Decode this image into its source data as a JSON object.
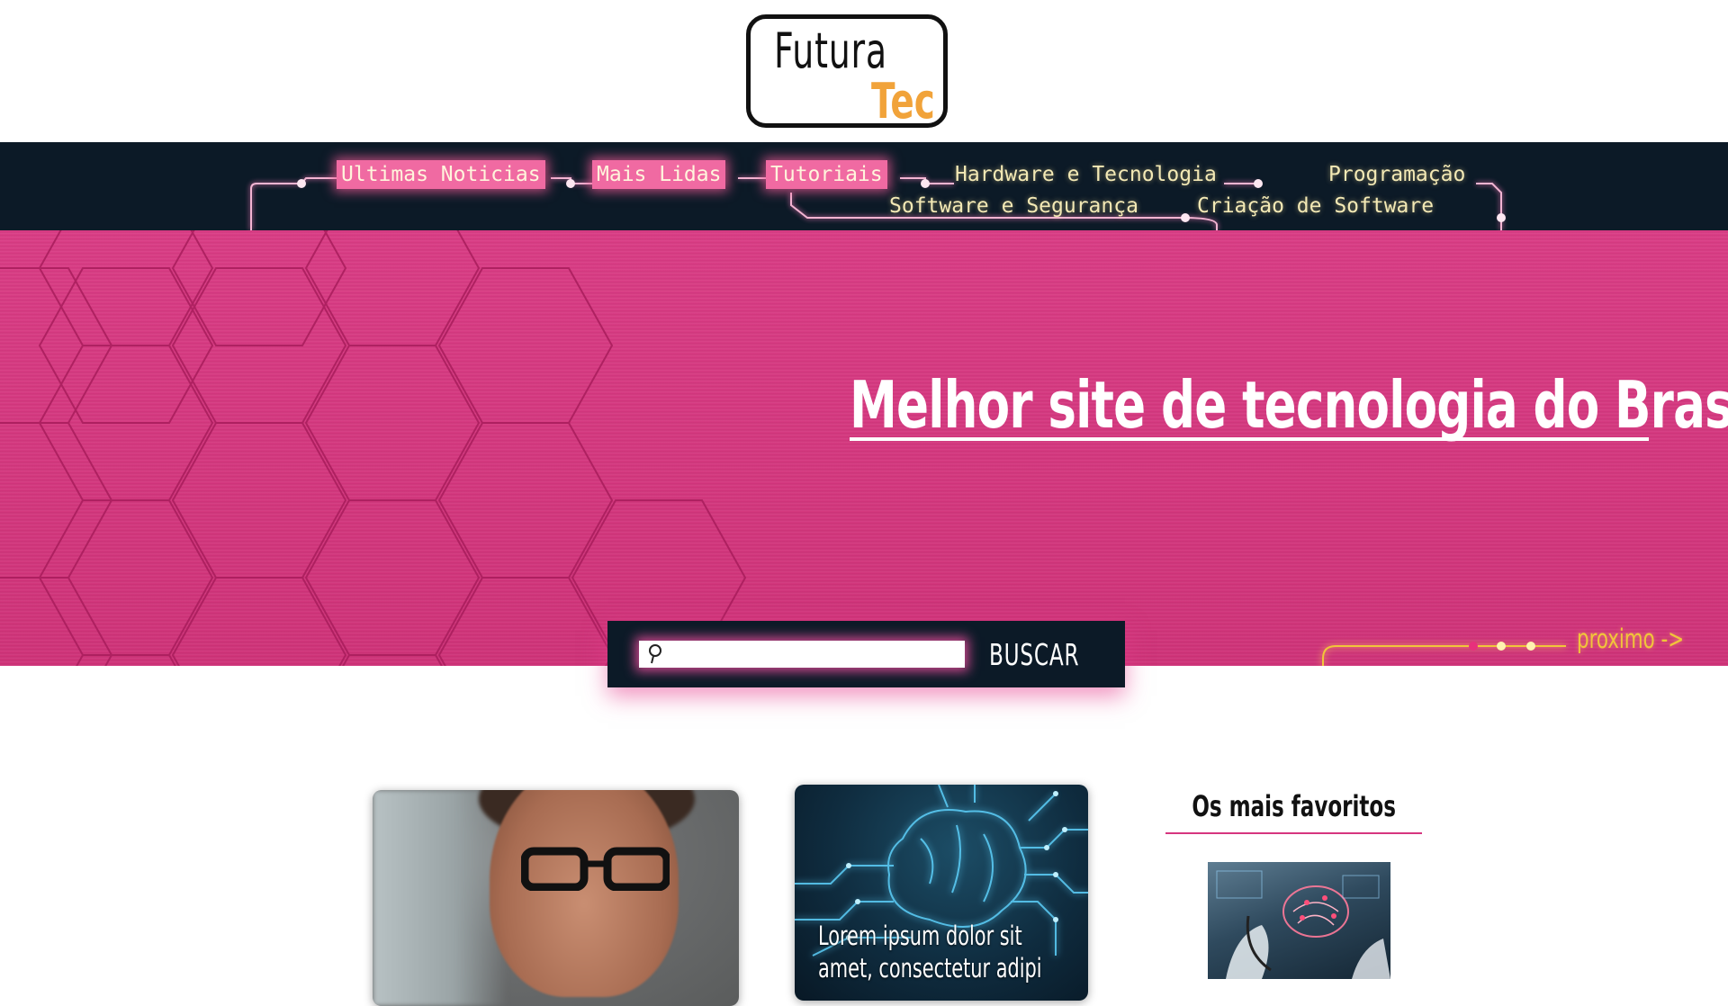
{
  "logo": {
    "line1": "Futura",
    "line2": "Tec"
  },
  "nav": {
    "items": [
      "Ultimas Noticias",
      "Mais Lidas",
      "Tutoriais",
      "Hardware e Tecnologia",
      "Programação",
      "Software e Segurança",
      "Criação de Software"
    ]
  },
  "hero": {
    "title": "Melhor site de tecnologia do Brasil",
    "next_label": "proximo ->"
  },
  "search": {
    "placeholder": "",
    "button_label": "BUSCAR"
  },
  "cards": [
    {
      "image": "boy-with-glasses-photo"
    },
    {
      "image": "circuit-brain-photo",
      "text": "Lorem ipsum dolor sit amet, consectetur adipi"
    }
  ],
  "favorites": {
    "title": "Os mais favoritos",
    "image": "doctor-brain-hologram-photo"
  },
  "colors": {
    "brand_pink": "#d6367f",
    "nav_dark": "#0c1a27",
    "logo_orange": "#f1a33a",
    "accent_yellow": "#f1c53a"
  }
}
